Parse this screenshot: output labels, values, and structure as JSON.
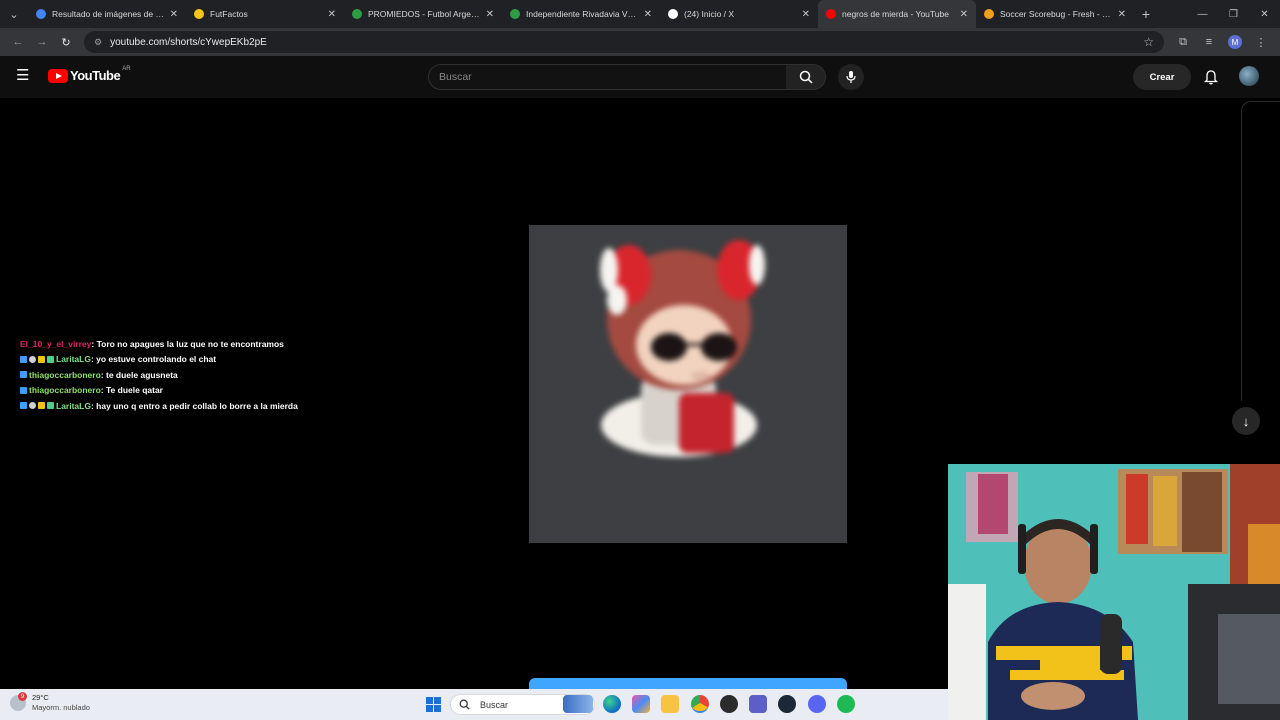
{
  "browser": {
    "tabs": [
      {
        "title": "Resultado de imágenes de Goo",
        "favicon_color": "#4285f4",
        "active": false
      },
      {
        "title": "FutFactos",
        "favicon_color": "#f5c518",
        "active": false
      },
      {
        "title": "PROMIEDOS - Futbol Argentino",
        "favicon_color": "#2e9e44",
        "active": false
      },
      {
        "title": "Independiente Rivadavia Vs Riv",
        "favicon_color": "#2e9e44",
        "active": false
      },
      {
        "title": "(24) Inicio / X",
        "favicon_color": "#ffffff",
        "active": false
      },
      {
        "title": "negros de mierda - YouTube",
        "favicon_color": "#ff0000",
        "active": true
      },
      {
        "title": "Soccer Scorebug - Fresh - over",
        "favicon_color": "#f0a020",
        "active": false
      }
    ],
    "tab_close": "✕",
    "new_tab": "+",
    "url": "youtube.com/shorts/cYwepEKb2pE",
    "profile_initial": "M"
  },
  "youtube": {
    "logo_text": "YouTube",
    "country_code": "AR",
    "search_placeholder": "Buscar",
    "create_label": "Crear"
  },
  "chat": [
    {
      "user": "El_10_y_el_virrey",
      "user_color": "#e0246a",
      "message": ": Toro no apagues la luz que no te encontramos",
      "badges": 0
    },
    {
      "user": "LaritaLG",
      "user_color": "#7fe08a",
      "message": ": yo estuve controlando el chat",
      "badges": 4
    },
    {
      "user": "thiagoccarbonero",
      "user_color": "#8fe06a",
      "message": ": te duele agusneta",
      "badges": 1
    },
    {
      "user": "thiagoccarbonero",
      "user_color": "#8fe06a",
      "message": ": Te duele qatar",
      "badges": 1
    },
    {
      "user": "LaritaLG",
      "user_color": "#7fe08a",
      "message": ": hay uno q entro a pedir collab lo borre a la mierda",
      "badges": 4
    }
  ],
  "taskbar": {
    "temperature": "29°C",
    "condition": "Mayorm. nublado",
    "weather_alert_count": "9",
    "search_placeholder": "Buscar"
  },
  "colors": {
    "yt_red": "#ff0000",
    "accent_blue": "#3ea6ff"
  },
  "icons": [
    "tab-search-icon",
    "reload-icon",
    "star-icon",
    "extensions-icon",
    "media-icon",
    "menu-dots-icon",
    "hamburger-icon",
    "search-icon",
    "mic-icon",
    "bell-icon",
    "arrow-down-icon",
    "windows-start-icon"
  ]
}
